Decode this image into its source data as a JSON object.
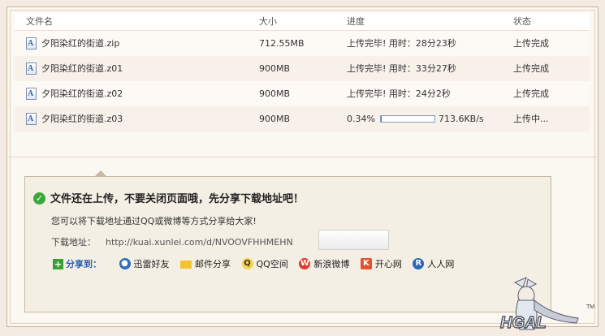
{
  "table": {
    "headers": {
      "name": "文件名",
      "size": "大小",
      "progress": "进度",
      "status": "状态"
    },
    "rows": [
      {
        "name": "夕阳染红的街道.zip",
        "size": "712.55MB",
        "progress": "上传完毕! 用时：28分23秒",
        "status": "上传完成"
      },
      {
        "name": "夕阳染红的街道.z01",
        "size": "900MB",
        "progress": "上传完毕! 用时：33分27秒",
        "status": "上传完成"
      },
      {
        "name": "夕阳染红的街道.z02",
        "size": "900MB",
        "progress": "上传完毕! 用时：24分2秒",
        "status": "上传完成"
      },
      {
        "name": "夕阳染红的街道.z03",
        "size": "900MB",
        "percent": "0.34%",
        "progress_fraction": 0.0034,
        "speed": "713.6KB/s",
        "status": "上传中..."
      }
    ]
  },
  "share_panel": {
    "headline": "文件还在上传，不要关闭页面哦，先分享下载地址吧！",
    "subtext": "您可以将下载地址通过QQ或微博等方式分享给大家!",
    "download_label": "下载地址：",
    "download_url": "http://kuai.xunlei.com/d/NVOOVFHHMEHN",
    "share_to_label": "分享到：",
    "share_items": [
      {
        "label": "迅雷好友",
        "icon": "xunlei-friends-icon"
      },
      {
        "label": "邮件分享",
        "icon": "mail-icon"
      },
      {
        "label": "QQ空间",
        "icon": "qzone-icon"
      },
      {
        "label": "新浪微博",
        "icon": "sina-weibo-icon"
      },
      {
        "label": "开心网",
        "icon": "kaixin-icon"
      },
      {
        "label": "人人网",
        "icon": "renren-icon"
      }
    ]
  },
  "colors": {
    "progress_fill": "#4a78c4",
    "accent_blue": "#2a5fb0",
    "check_green": "#3da63d"
  }
}
